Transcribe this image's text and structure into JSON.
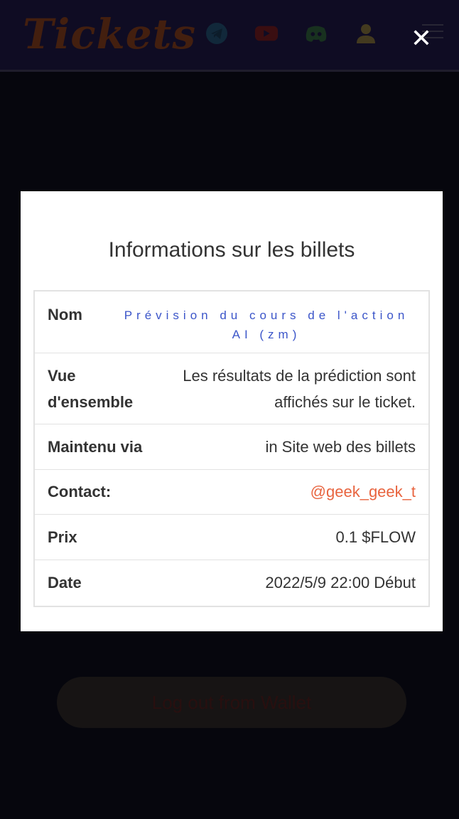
{
  "header": {
    "logo": "Tickets"
  },
  "icons": {
    "telegram": "telegram-icon",
    "youtube": "youtube-icon",
    "discord": "discord-icon",
    "user": "user-icon",
    "menu": "menu-icon",
    "close": "close-icon"
  },
  "background": {
    "logout_label": "Log out from Wallet"
  },
  "modal": {
    "title": "Informations sur les billets",
    "rows": [
      {
        "label": "Nom",
        "value": "Prévision du cours de l'action AI (zm)"
      },
      {
        "label": "Vue d'ensemble",
        "value": "Les résultats de la prédiction sont affichés sur le ticket."
      },
      {
        "label": "Maintenu via",
        "value": "in Site web des billets"
      },
      {
        "label": "Contact:",
        "value": "@geek_geek_t"
      },
      {
        "label": "Prix",
        "value": "0.1 $FLOW"
      },
      {
        "label": "Date",
        "value": "2022/5/9 22:00 Début"
      }
    ]
  },
  "colors": {
    "header_bg": "#1d1640",
    "name_link": "#3b55c9",
    "contact_link": "#e8643f",
    "logo": "#7a3a1c"
  }
}
